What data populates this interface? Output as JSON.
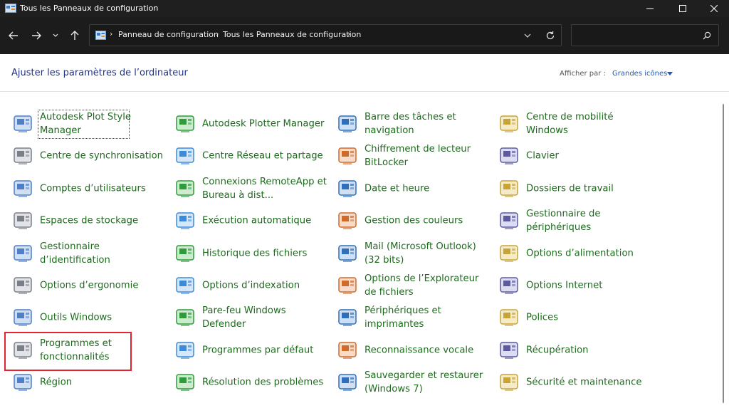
{
  "window": {
    "title": "Tous les Panneaux de configuration"
  },
  "address": {
    "crumbs": [
      "Panneau de configuration",
      "Tous les Panneaux de configuration"
    ]
  },
  "search": {
    "placeholder": ""
  },
  "header": {
    "title": "Ajuster les paramètres de l’ordinateur",
    "viewby_label": "Afficher par :",
    "viewby_value": "Grandes icônes"
  },
  "items": [
    [
      "Autodesk Plot Style Manager",
      "Autodesk Plotter Manager",
      "Barre des tâches et navigation",
      "Centre de mobilité Windows"
    ],
    [
      "Centre de synchronisation",
      "Centre Réseau et partage",
      "Chiffrement de lecteur BitLocker",
      "Clavier"
    ],
    [
      "Comptes d’utilisateurs",
      "Connexions RemoteApp et Bureau à dist...",
      "Date et heure",
      "Dossiers de travail"
    ],
    [
      "Espaces de stockage",
      "Exécution automatique",
      "Gestion des couleurs",
      "Gestionnaire de périphériques"
    ],
    [
      "Gestionnaire d’identification",
      "Historique des fichiers",
      "Mail (Microsoft Outlook) (32 bits)",
      "Options d’alimentation"
    ],
    [
      "Options d’ergonomie",
      "Options d’indexation",
      "Options de l’Explorateur de fichiers",
      "Options Internet"
    ],
    [
      "Outils Windows",
      "Pare-feu Windows Defender",
      "Périphériques et imprimantes",
      "Polices"
    ],
    [
      "Programmes et fonctionnalités",
      "Programmes par défaut",
      "Reconnaissance vocale",
      "Récupération"
    ],
    [
      "Région",
      "Résolution des problèmes",
      "Sauvegarder et restaurer (Windows 7)",
      "Sécurité et maintenance"
    ]
  ],
  "highlighted_item": "Programmes et fonctionnalités"
}
